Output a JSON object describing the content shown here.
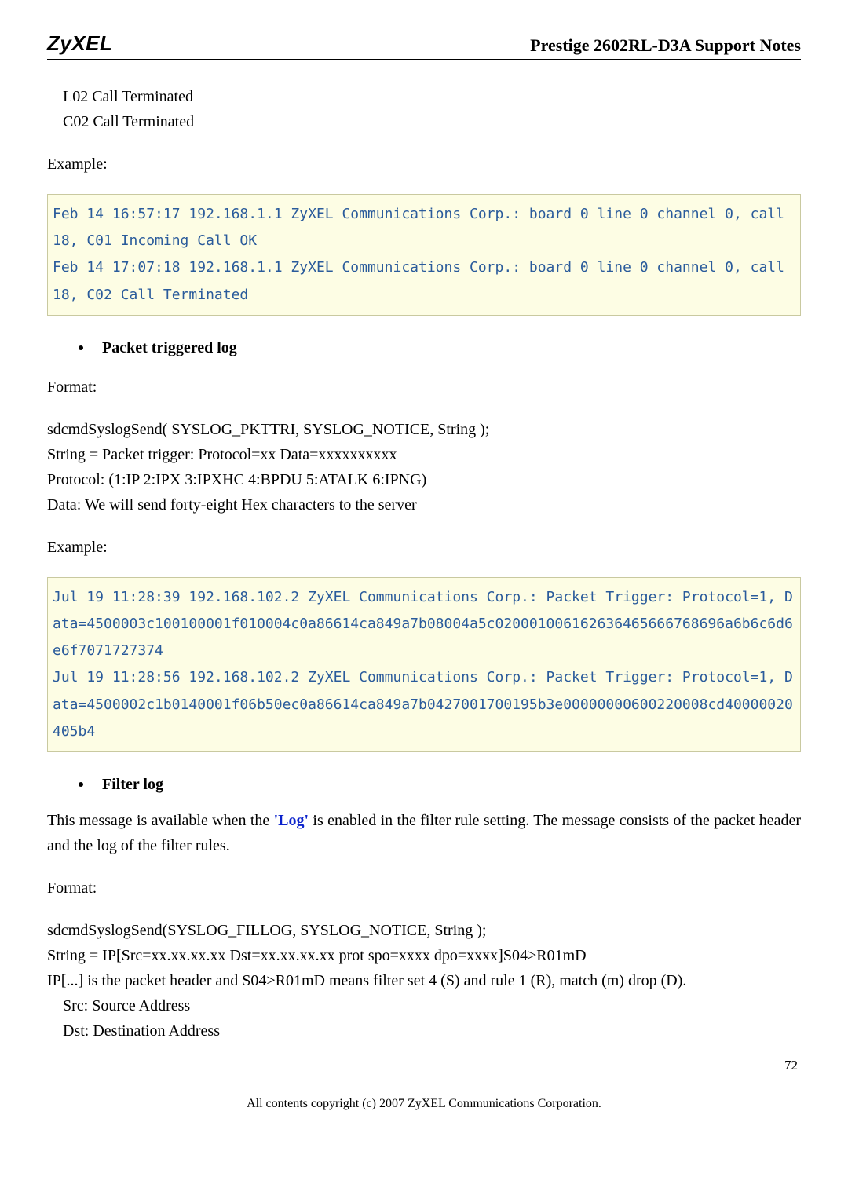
{
  "header": {
    "logo": "ZyXEL",
    "title": "Prestige 2602RL-D3A Support Notes"
  },
  "lines": {
    "l02": "L02 Call Terminated",
    "c02": "C02 Call Terminated"
  },
  "labels": {
    "example": "Example:",
    "format": "Format:"
  },
  "code1": {
    "line1": "Feb 14 16:57:17 192.168.1.1 ZyXEL Communications Corp.: board 0 line 0 channel 0, call 18, C01 Incoming Call OK",
    "line2": "Feb 14 17:07:18 192.168.1.1 ZyXEL Communications Corp.: board 0 line 0 channel 0, call 18, C02 Call Terminated"
  },
  "bullets": {
    "packet": "Packet triggered log",
    "filter": "Filter log"
  },
  "packet_format": {
    "l1": "sdcmdSyslogSend( SYSLOG_PKTTRI, SYSLOG_NOTICE, String );",
    "l2": "String = Packet trigger: Protocol=xx Data=xxxxxxxxxx",
    "l3": "Protocol: (1:IP 2:IPX 3:IPXHC 4:BPDU 5:ATALK 6:IPNG)",
    "l4": "Data: We will send forty-eight Hex characters to the server"
  },
  "code2": {
    "line1": "Jul 19 11:28:39 192.168.102.2 ZyXEL Communications Corp.: Packet Trigger: Protocol=1, Data=4500003c100100001f010004c0a86614ca849a7b08004a5c020001006162636465666768696a6b6c6d6e6f7071727374",
    "line2": "Jul 19 11:28:56 192.168.102.2 ZyXEL Communications Corp.: Packet Trigger: Protocol=1, Data=4500002c1b0140001f06b50ec0a86614ca849a7b0427001700195b3e00000000600220008cd40000020405b4"
  },
  "filter_text": {
    "p1a": "This message is available when the ",
    "log": "'Log'",
    "p1b": " is enabled in the filter rule setting. The message consists of the packet header and the log of the filter rules."
  },
  "filter_format": {
    "l1": "sdcmdSyslogSend(SYSLOG_FILLOG, SYSLOG_NOTICE, String );",
    "l2": "String = IP[Src=xx.xx.xx.xx Dst=xx.xx.xx.xx prot spo=xxxx dpo=xxxx]S04>R01mD",
    "l3": "IP[...] is the packet header and S04>R01mD means filter set 4 (S) and rule 1 (R), match (m) drop (D).",
    "l4": "Src: Source Address",
    "l5": "Dst: Destination Address"
  },
  "footer": {
    "pagenum": "72",
    "copyright": "All contents copyright (c) 2007 ZyXEL Communications Corporation."
  }
}
